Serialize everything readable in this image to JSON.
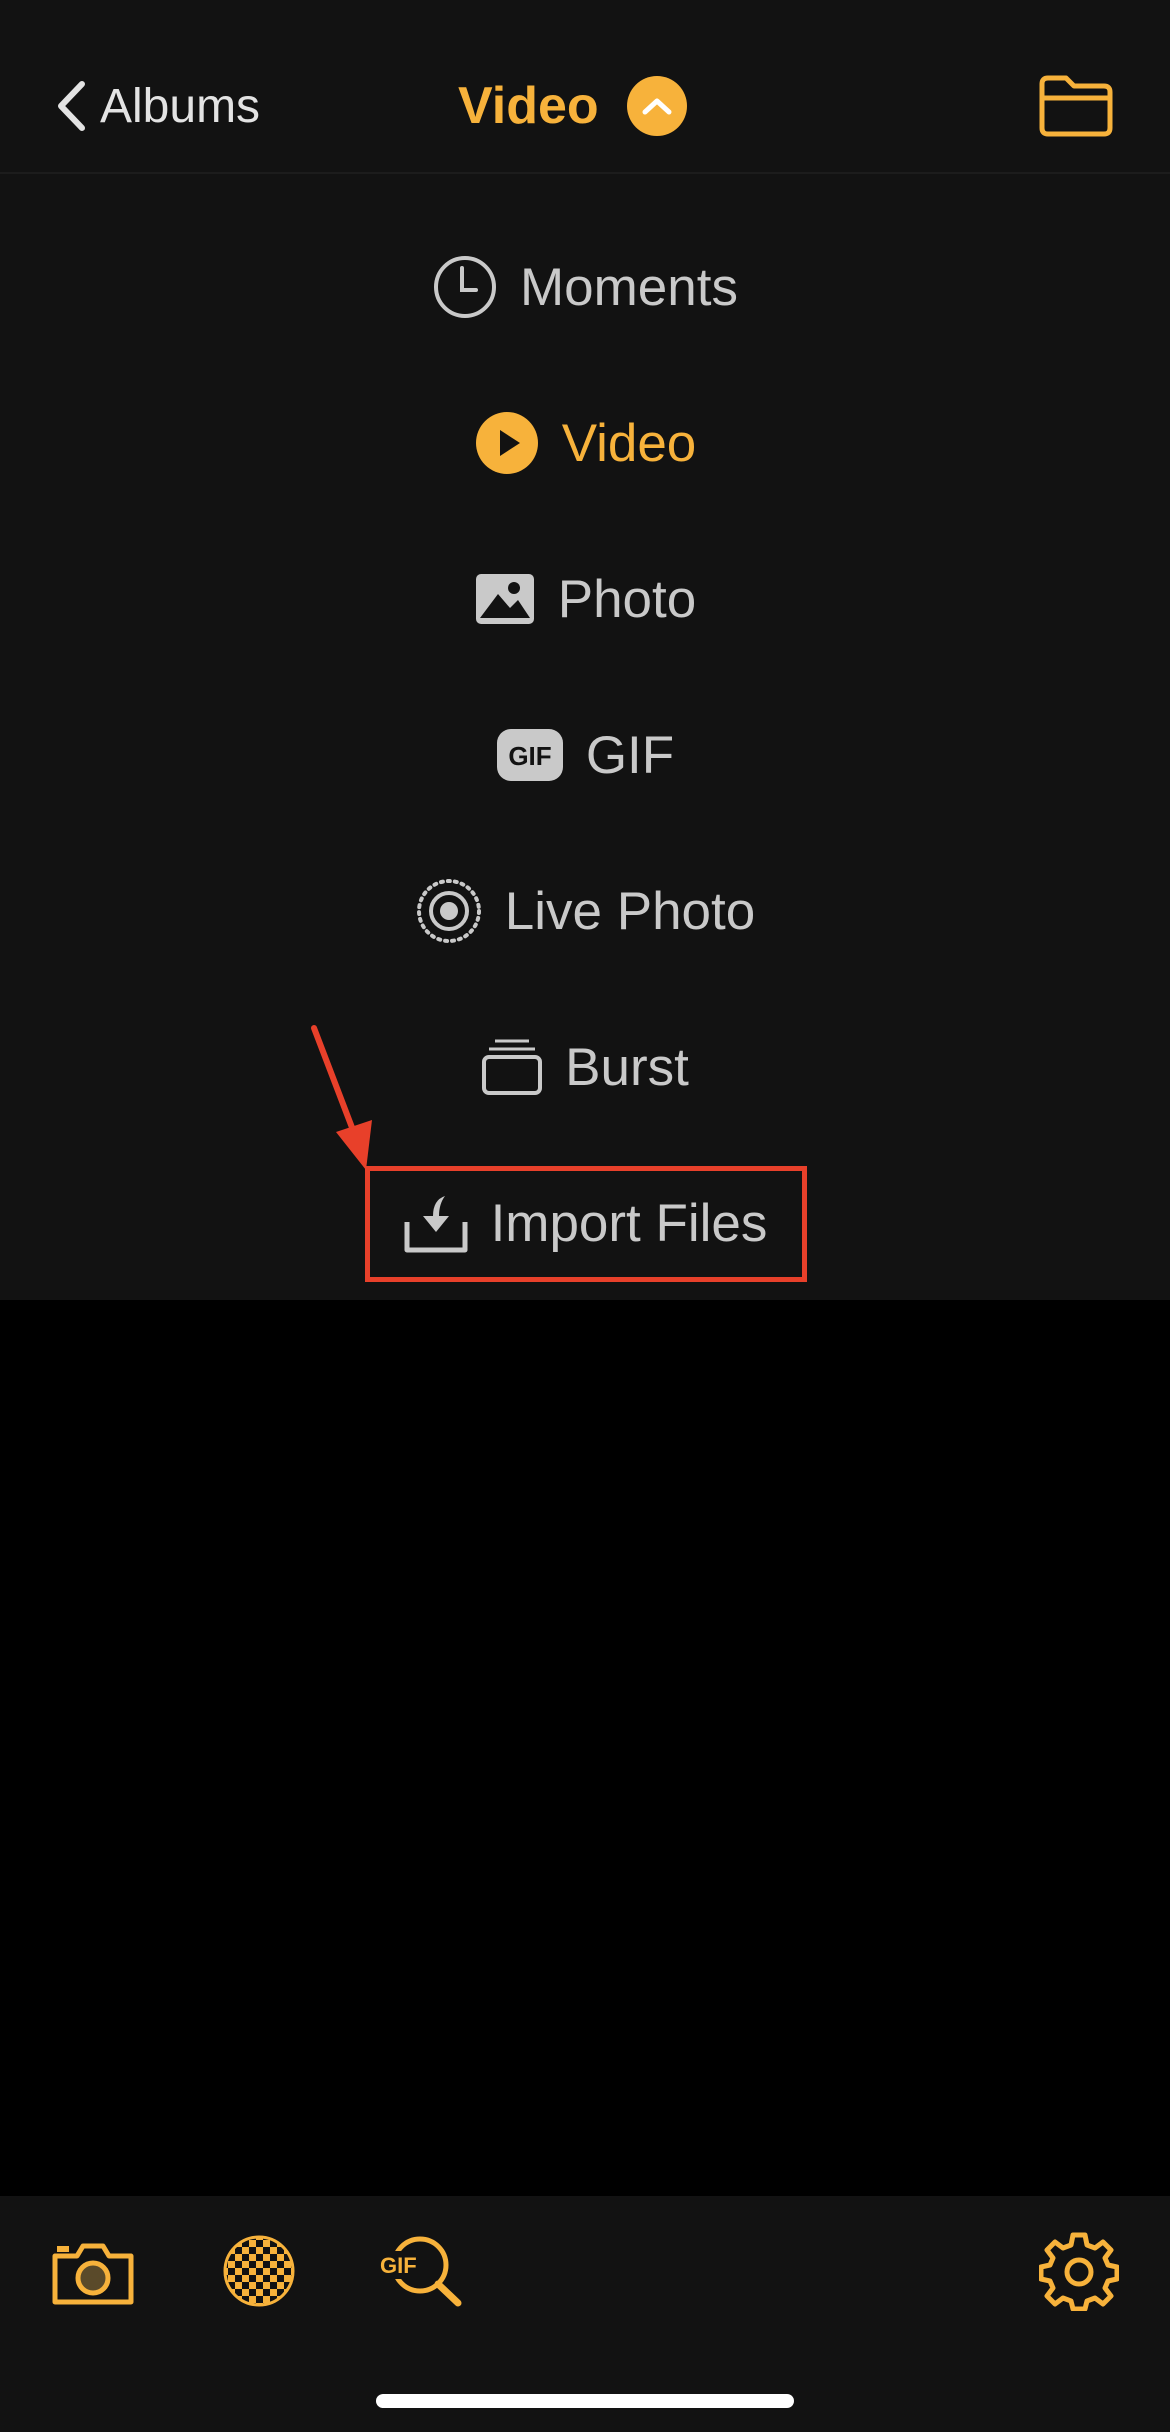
{
  "header": {
    "back_label": "Albums",
    "title": "Video"
  },
  "menu": {
    "items": [
      {
        "label": "Moments",
        "icon": "clock-icon",
        "active": false
      },
      {
        "label": "Video",
        "icon": "play-circle-icon",
        "active": true
      },
      {
        "label": "Photo",
        "icon": "photo-icon",
        "active": false
      },
      {
        "label": "GIF",
        "icon": "gif-badge-icon",
        "active": false
      },
      {
        "label": "Live Photo",
        "icon": "live-photo-icon",
        "active": false
      },
      {
        "label": "Burst",
        "icon": "burst-stack-icon",
        "active": false
      },
      {
        "label": "Import Files",
        "icon": "import-download-icon",
        "active": false,
        "highlighted": true
      }
    ]
  },
  "toolbar": {
    "icons": [
      "camera-icon",
      "checkerboard-icon",
      "gif-search-icon",
      "gear-icon"
    ]
  },
  "colors": {
    "accent": "#f7b23b",
    "text": "#c9c9c9",
    "background": "#121212",
    "annotation": "#e8402a"
  }
}
